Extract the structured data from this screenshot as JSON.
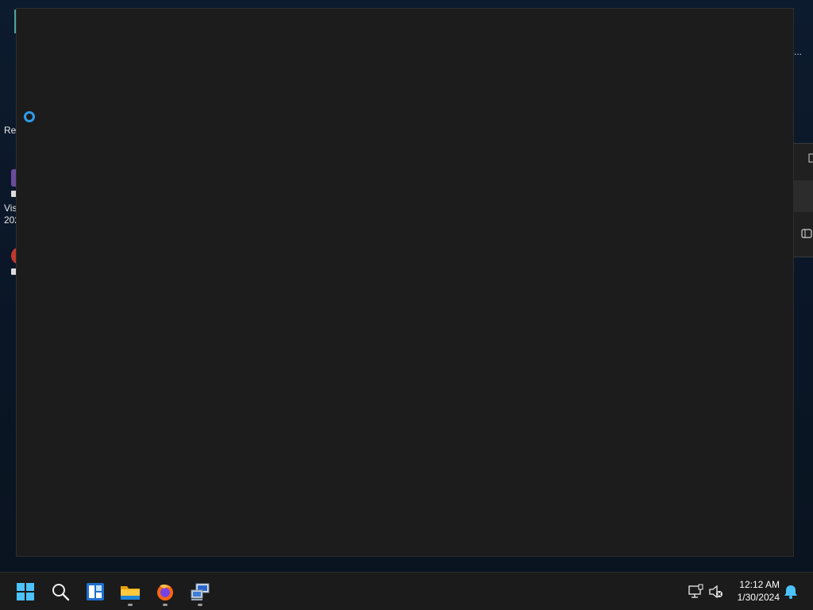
{
  "desktop": {
    "icons": [
      {
        "name": "recycle-bin",
        "label": "Re"
      },
      {
        "name": "visual-studio-2022",
        "label": "Vis\n202"
      },
      {
        "name": "shortcut-app",
        "label": ""
      }
    ],
    "background_window_ellipsis": "..."
  },
  "main_window": {
    "state": "loading"
  },
  "taskbar": {
    "items": [
      {
        "name": "start",
        "label": "Start",
        "icon": "windows-logo-icon",
        "running": false
      },
      {
        "name": "search",
        "label": "Search",
        "icon": "search-icon",
        "running": false
      },
      {
        "name": "widgets",
        "label": "Widgets",
        "icon": "widgets-icon",
        "running": false
      },
      {
        "name": "file-explorer",
        "label": "File Explorer",
        "icon": "folder-icon",
        "running": true
      },
      {
        "name": "firefox",
        "label": "Firefox",
        "icon": "firefox-icon",
        "running": true
      },
      {
        "name": "network-app",
        "label": "Remote Desktop",
        "icon": "network-computer-icon",
        "running": true
      }
    ],
    "tray": {
      "network_icon": "network-icon",
      "volume_icon": "volume-muted-icon",
      "time": "12:12 AM",
      "date": "1/30/2024",
      "notification_icon": "bell-icon"
    }
  },
  "colors": {
    "accent": "#2f9bea",
    "window_bg": "#1c1c1c",
    "taskbar_bg": "#1b1b1b"
  }
}
